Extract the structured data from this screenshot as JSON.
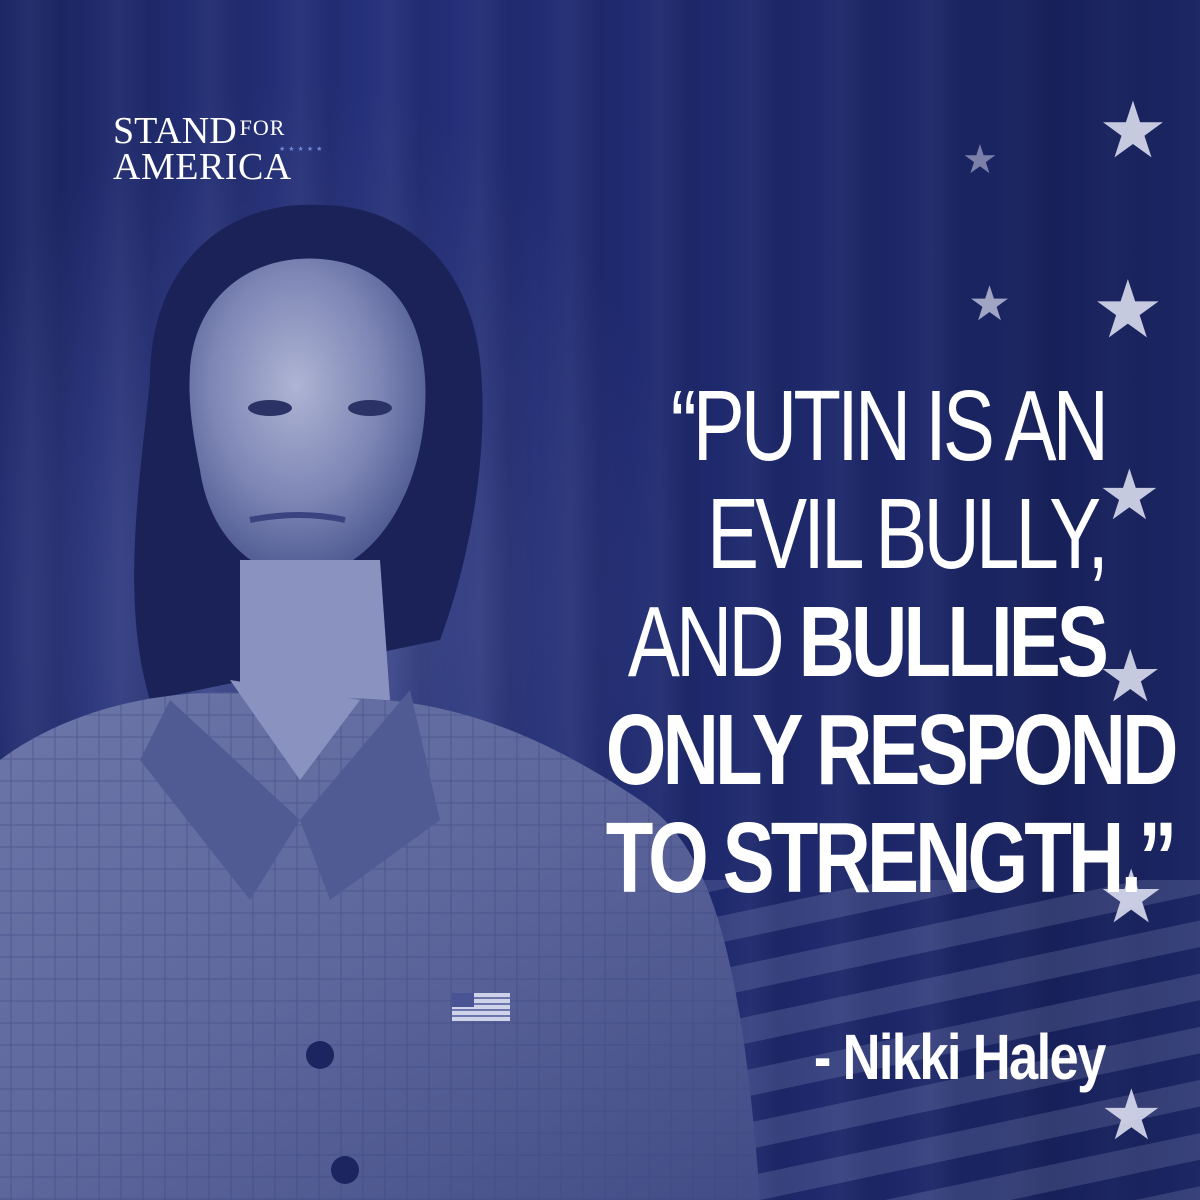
{
  "logo": {
    "stand": "STAND",
    "for": "FOR",
    "america": "AMERICA",
    "stars": "★★★★★"
  },
  "quote": {
    "line1": "“PUTIN IS AN",
    "line2": "EVIL BULLY,",
    "line3_light": "AND ",
    "line3_bold": "BULLIES",
    "line4": "ONLY RESPOND",
    "line5": "TO STRENGTH.”"
  },
  "attribution": "- Nikki Haley",
  "colors": {
    "background": "#1f2a6b",
    "text": "#ffffff",
    "logo_stars": "#6f86d9"
  }
}
